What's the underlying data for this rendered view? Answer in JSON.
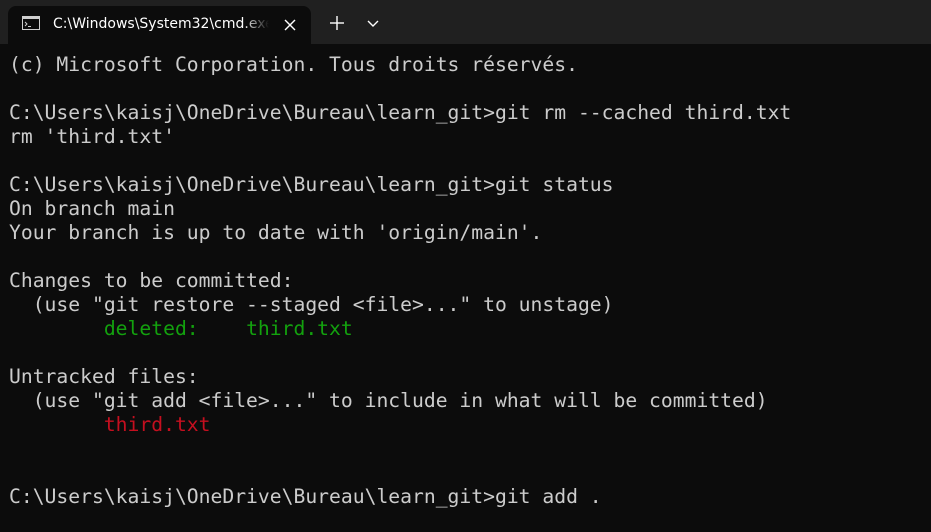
{
  "window": {
    "tab_title": "C:\\Windows\\System32\\cmd.exe",
    "new_tab_icon": "plus-icon",
    "dropdown_icon": "chevron-down-icon",
    "close_icon": "close-icon",
    "tab_icon": "command-prompt-icon"
  },
  "colors": {
    "background": "#0c0c0c",
    "titlebar": "#202020",
    "text": "#cccccc",
    "staged": "#13a10e",
    "untracked": "#c50f1f"
  },
  "console": {
    "copyright": "(c) Microsoft Corporation. Tous droits réservés.",
    "cmd_rm": "C:\\Users\\kaisj\\OneDrive\\Bureau\\learn_git>git rm --cached third.txt",
    "rm_output": "rm 'third.txt'",
    "cmd_status": "C:\\Users\\kaisj\\OneDrive\\Bureau\\learn_git>git status",
    "on_branch": "On branch main",
    "up_to_date": "Your branch is up to date with 'origin/main'.",
    "changes_header": "Changes to be committed:",
    "restore_hint": "  (use \"git restore --staged <file>...\" to unstage)",
    "deleted_indent": "        ",
    "deleted_entry": "deleted:    third.txt",
    "untracked_header": "Untracked files:",
    "add_hint": "  (use \"git add <file>...\" to include in what will be committed)",
    "untracked_indent": "        ",
    "untracked_entry": "third.txt",
    "cmd_add": "C:\\Users\\kaisj\\OneDrive\\Bureau\\learn_git>git add ."
  }
}
